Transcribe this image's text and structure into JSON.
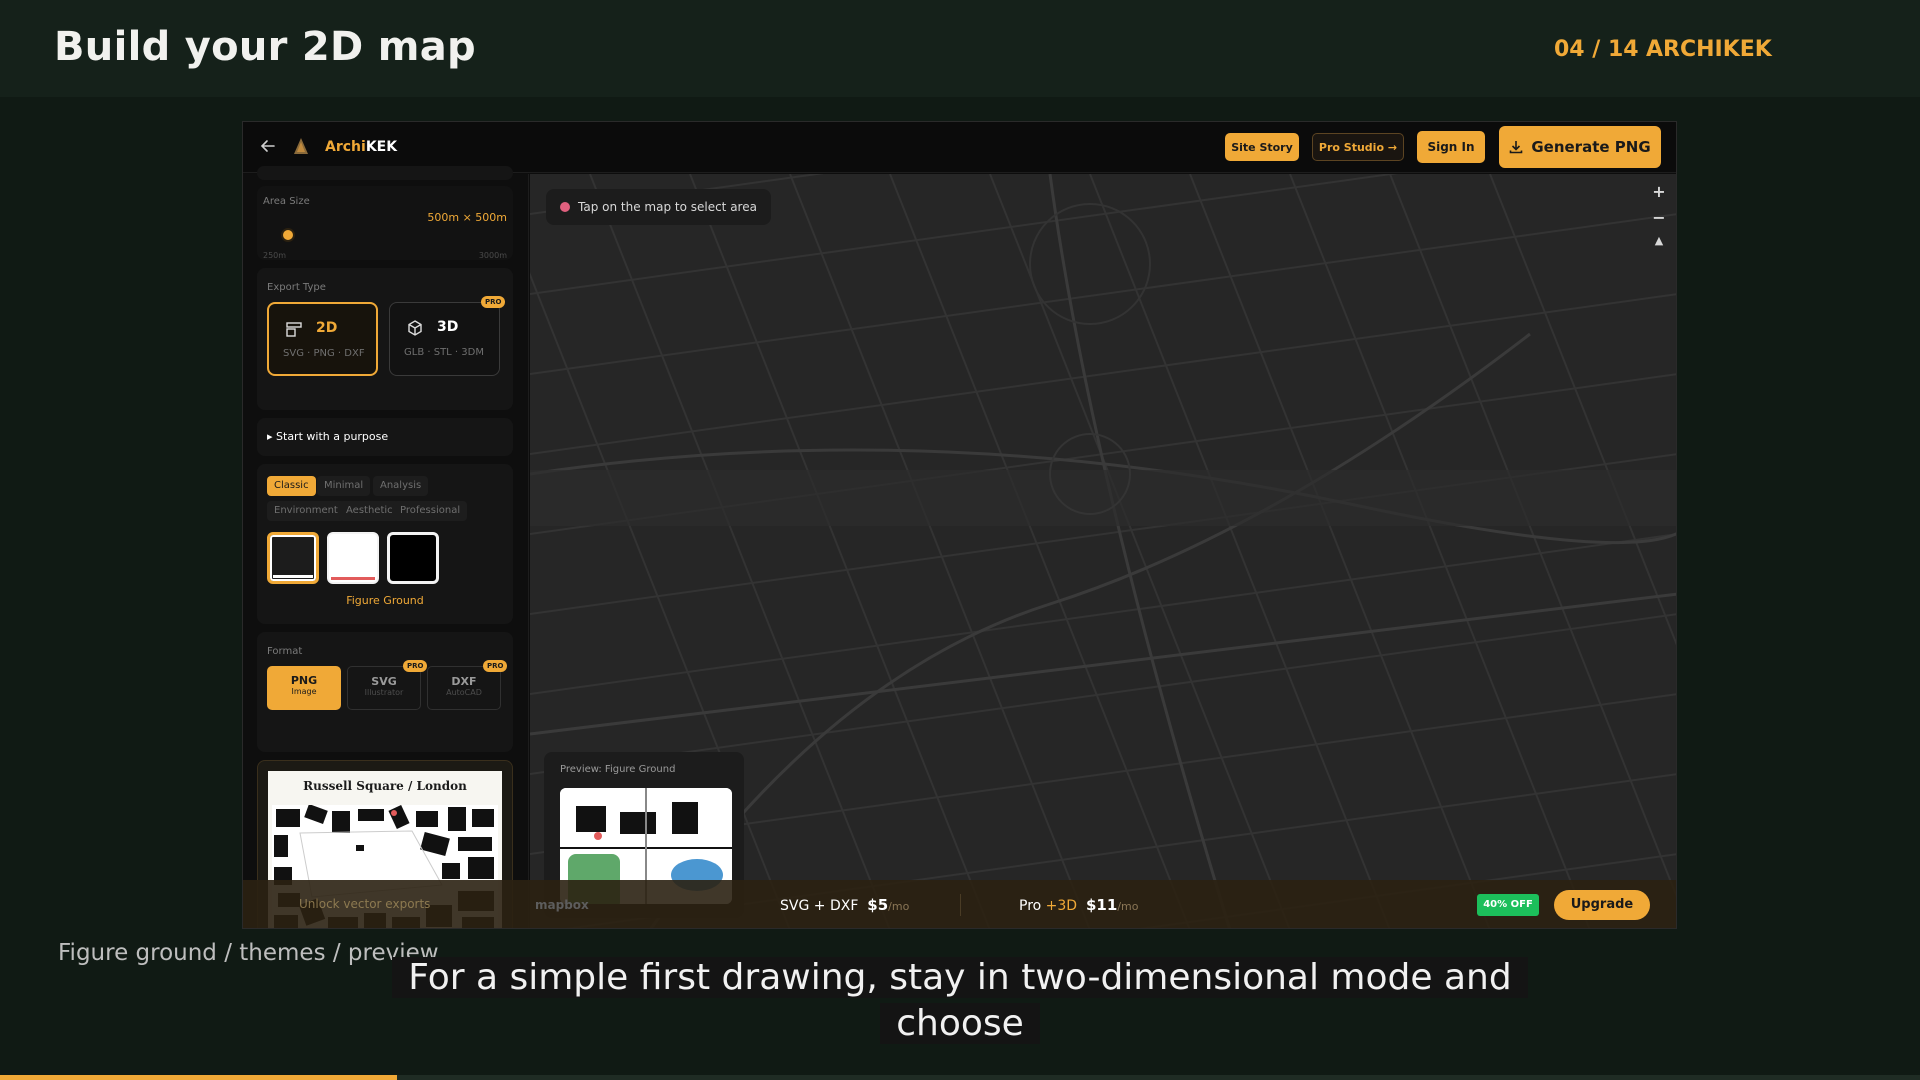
{
  "slide": {
    "title": "Build your 2D map",
    "counter": "04 / 14",
    "brand": "ARCHIKEK",
    "caption": "Figure ground / themes / preview",
    "subtitle_line1": "For a simple first drawing, stay in two-dimensional mode and",
    "subtitle_line2": "choose",
    "progress_fraction": 0.207
  },
  "app": {
    "name_part1": "Archi",
    "name_part2": "KEK",
    "buttons": {
      "site_story": "Site Story",
      "pro_studio": "Pro Studio →",
      "sign_in": "Sign In",
      "generate": "Generate PNG"
    }
  },
  "sidebar": {
    "area": {
      "label": "Area Size",
      "value": "500m × 500m",
      "min": "250m",
      "max": "3000m",
      "slider_fraction": 0.09
    },
    "export": {
      "label": "Export Type",
      "options": [
        {
          "title": "2D",
          "sub": "SVG · PNG · DXF"
        },
        {
          "title": "3D",
          "sub": "GLB · STL · 3DM",
          "badge": "PRO"
        }
      ]
    },
    "purpose": "▸ Start with a purpose",
    "theme_tabs": [
      "Classic",
      "Minimal",
      "Analysis",
      "Environment",
      "Aesthetic",
      "Professional"
    ],
    "selected_theme": "Figure Ground",
    "format": {
      "label": "Format",
      "options": [
        {
          "title": "PNG",
          "sub": "Image"
        },
        {
          "title": "SVG",
          "sub": "Illustrator",
          "badge": "PRO"
        },
        {
          "title": "DXF",
          "sub": "AutoCAD",
          "badge": "PRO"
        }
      ]
    },
    "poster_title": "Russell Square / London"
  },
  "map": {
    "hint": "Tap on the map to select area",
    "zoom_in": "+",
    "zoom_out": "−",
    "compass": "▲",
    "preview_label": "Preview: Figure Ground"
  },
  "promo": {
    "unlock": "Unlock vector exports",
    "mapbox": "mapbox",
    "plan1_name": "SVG + DXF",
    "plan1_price": "$5",
    "plan2_name": "Pro",
    "plan2_plus": "+3D",
    "plan2_price": "$11",
    "per": "/mo",
    "discount": "40% OFF",
    "upgrade": "Upgrade"
  },
  "colors": {
    "accent": "#f0a937",
    "background": "#101a14",
    "map": "#262626",
    "success": "#1cbf5b"
  }
}
